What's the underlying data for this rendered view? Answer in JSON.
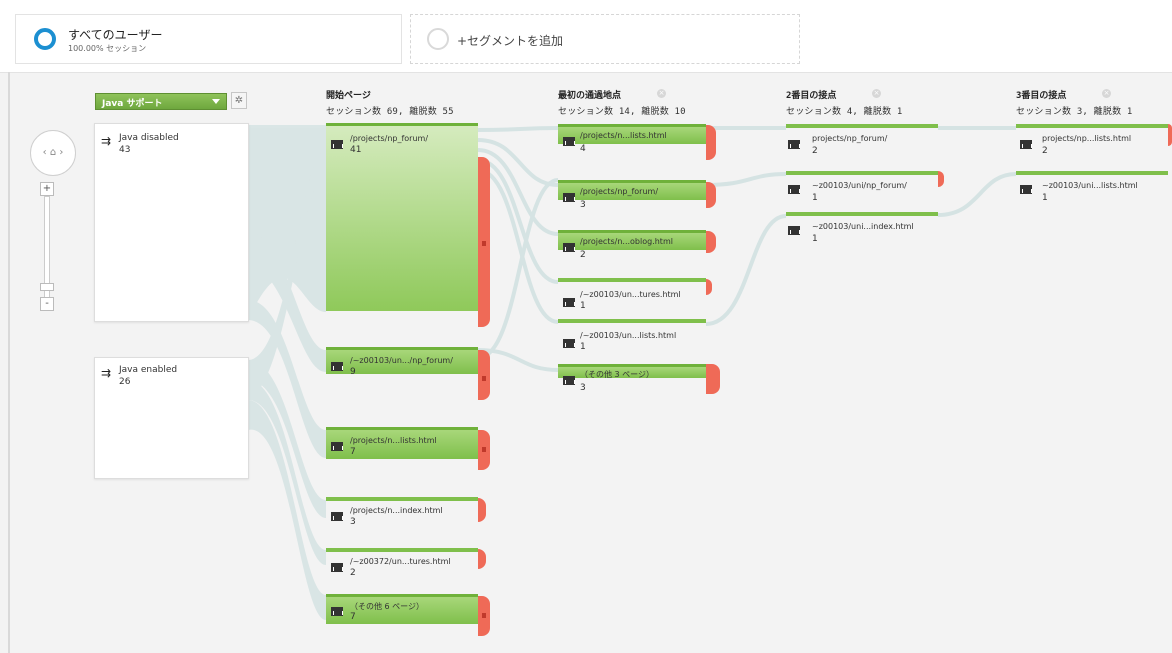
{
  "segments": {
    "all_users": {
      "title": "すべてのユーザー",
      "subtitle": "100.00% セッション"
    },
    "add_segment": "+セグメントを追加"
  },
  "controls": {
    "dimension_dropdown": "Java サポート",
    "zoom_in": "+",
    "zoom_out": "-"
  },
  "columns": [
    {
      "title": "開始ページ",
      "sub": "セッション数 69, 離脱数 55"
    },
    {
      "title": "最初の通過地点",
      "sub": "セッション数 14, 離脱数 10"
    },
    {
      "title": "2番目の接点",
      "sub": "セッション数 4, 離脱数 1"
    },
    {
      "title": "3番目の接点",
      "sub": "セッション数 3, 離脱数 1"
    }
  ],
  "sources": [
    {
      "label": "Java disabled",
      "count": "43"
    },
    {
      "label": "Java enabled",
      "count": "26"
    }
  ],
  "start_pages": [
    {
      "label": "/projects/np_forum/",
      "count": "41"
    },
    {
      "label": "/~z00103/un.../np_forum/",
      "count": "9"
    },
    {
      "label": "/projects/n...lists.html",
      "count": "7"
    },
    {
      "label": "/projects/n...index.html",
      "count": "3"
    },
    {
      "label": "/~z00372/un...tures.html",
      "count": "2"
    },
    {
      "label": "（その他 6 ページ）",
      "count": "7"
    }
  ],
  "first_interactions": [
    {
      "label": "/projects/n...lists.html",
      "count": "4"
    },
    {
      "label": "/projects/np_forum/",
      "count": "3"
    },
    {
      "label": "/projects/n...oblog.html",
      "count": "2"
    },
    {
      "label": "/~z00103/un...tures.html",
      "count": "1"
    },
    {
      "label": "/~z00103/un...lists.html",
      "count": "1"
    },
    {
      "label": "（その他 3 ページ）",
      "count": "3"
    }
  ],
  "second_interactions": [
    {
      "label": "projects/np_forum/",
      "count": "2"
    },
    {
      "label": "~z00103/uni/np_forum/",
      "count": "1"
    },
    {
      "label": "~z00103/uni...index.html",
      "count": "1"
    }
  ],
  "third_interactions": [
    {
      "label": "projects/np...lists.html",
      "count": "2"
    },
    {
      "label": "~z00103/uni...lists.html",
      "count": "1"
    }
  ],
  "colors": {
    "node_green": "#7fbf4b",
    "dropoff_red": "#ef6a57",
    "flow": "#d6e2e2",
    "ring_blue": "#1c8fd1"
  }
}
